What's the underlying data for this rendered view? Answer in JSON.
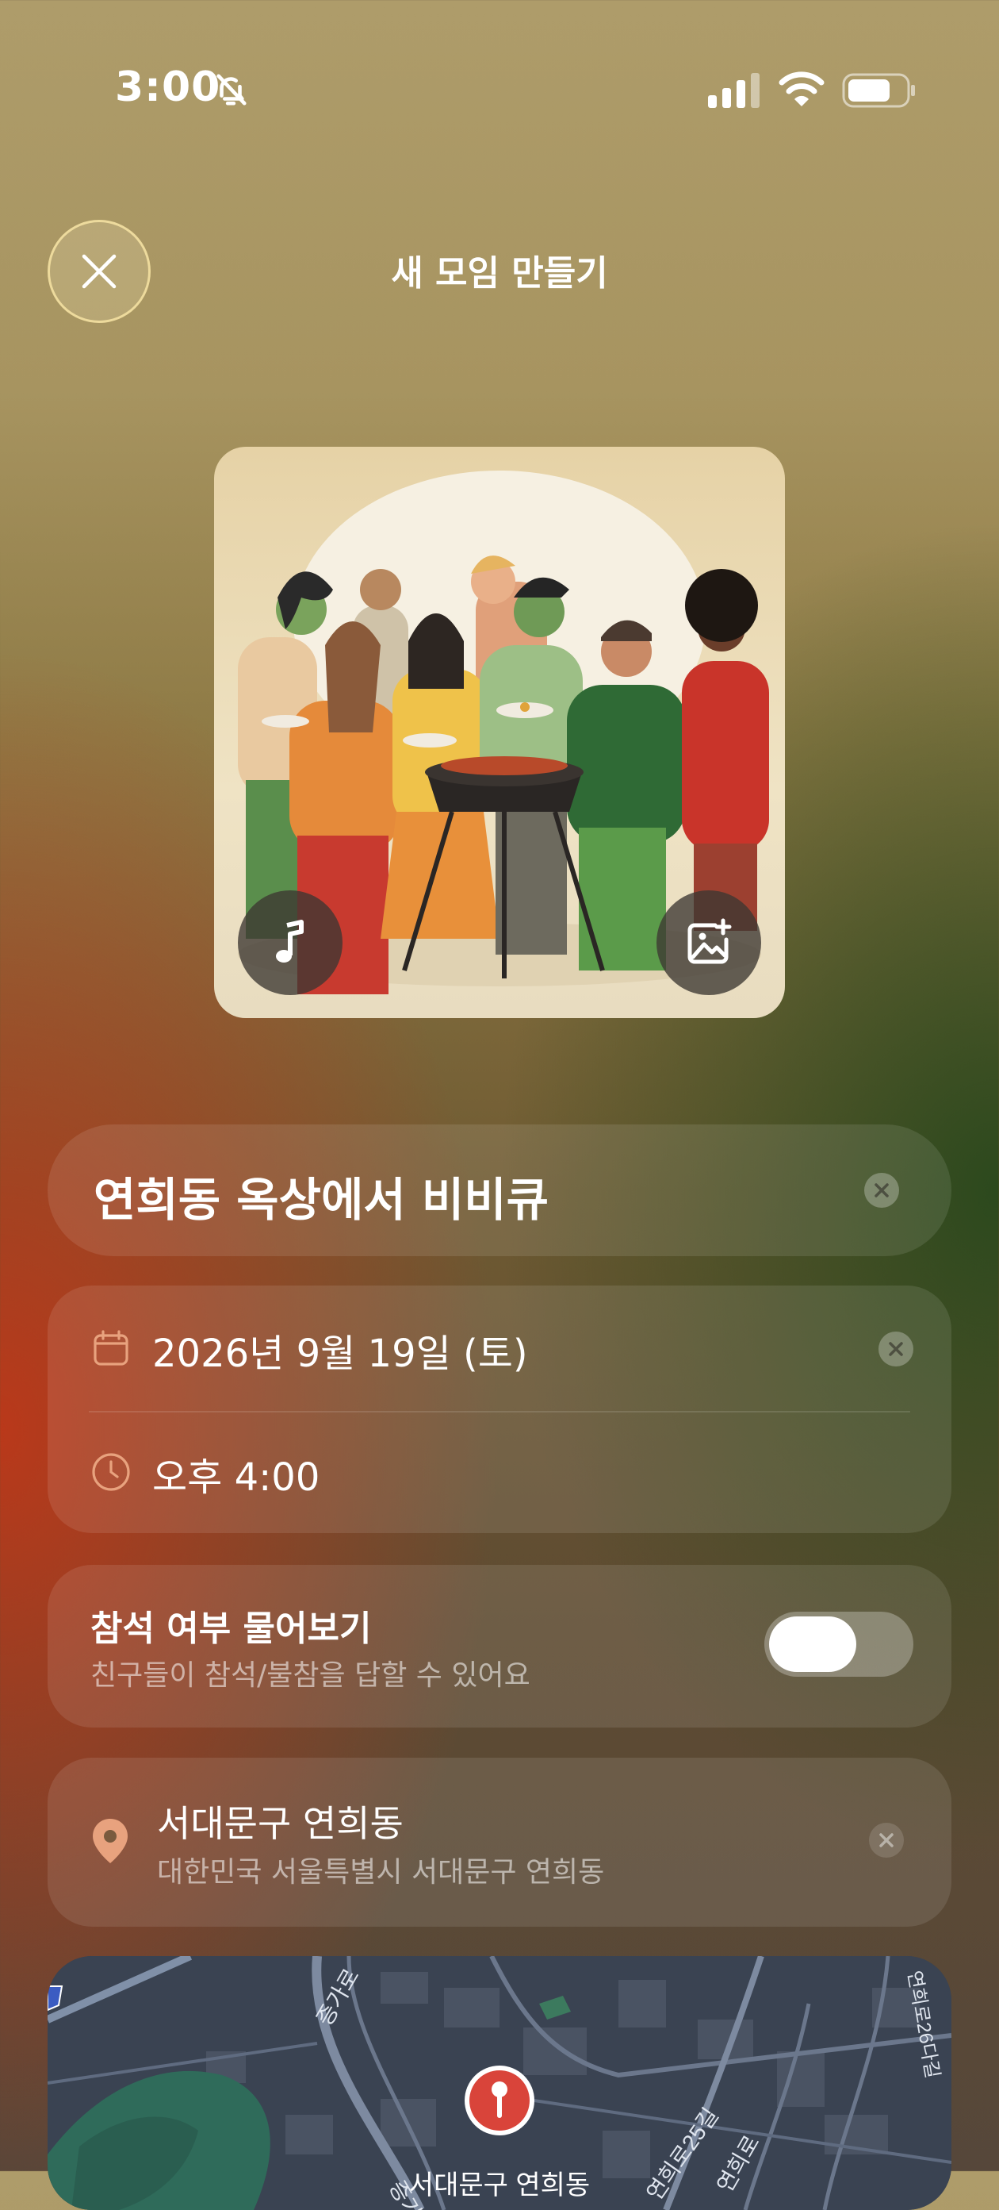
{
  "status_bar": {
    "time": "3:00",
    "icons": [
      "bell-slash-icon",
      "signal-icon",
      "wifi-icon",
      "battery-icon"
    ]
  },
  "header": {
    "title": "새 모임 만들기",
    "close_icon": "close-icon"
  },
  "cover": {
    "image": "friends-barbecue-illustration",
    "music_icon": "music-note-icon",
    "change_image_icon": "image-add-icon"
  },
  "event": {
    "title": "연희동 옥상에서 비비큐"
  },
  "datetime": {
    "date": "2026년 9월 19일 (토)",
    "time": "오후 4:00",
    "date_icon": "calendar-icon",
    "time_icon": "clock-icon"
  },
  "rsvp": {
    "title": "참석 여부 물어보기",
    "subtitle": "친구들이 참석/불참을 답할 수 있어요",
    "enabled": false
  },
  "location": {
    "name": "서대문구 연희동",
    "address": "대한민국 서울특별시 서대문구 연희동",
    "icon": "location-pin-icon"
  },
  "map": {
    "road_labels": [
      "증가로",
      "연희로25길",
      "연희로",
      "연희로26다길"
    ],
    "marker_label": "서대문구 연희동"
  },
  "colors": {
    "accent_red": "#d9443a",
    "toggle_off": "#bdbdb0"
  }
}
